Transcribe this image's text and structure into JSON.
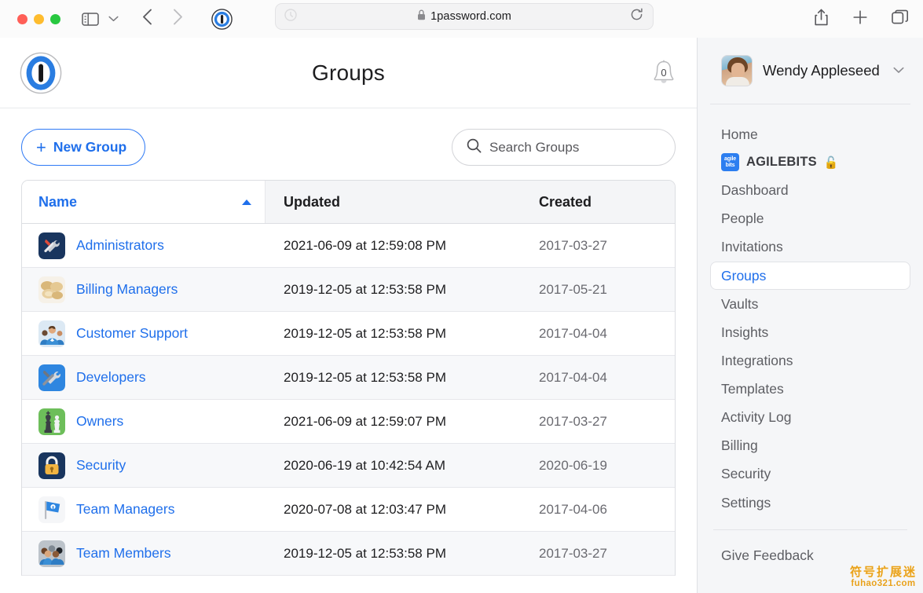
{
  "browser": {
    "url": "1password.com",
    "lock_icon": "lock-icon",
    "traffic_lights": [
      "close",
      "minimize",
      "maximize"
    ],
    "toolbar_icons": [
      "sidebar-toggle-icon",
      "chevron-down-icon",
      "back-arrow-icon",
      "forward-arrow-icon",
      "onepassword-extension-icon",
      "shield-icon",
      "reload-icon",
      "share-icon",
      "new-tab-icon",
      "tab-overview-icon"
    ]
  },
  "header": {
    "title": "Groups",
    "logo_icon": "onepassword-logo-icon",
    "notification_icon": "bell-icon",
    "notification_count": "0"
  },
  "actions": {
    "new_group_label": "New Group",
    "new_group_plus": "+",
    "search_placeholder": "Search Groups",
    "search_value": "",
    "search_icon": "search-icon"
  },
  "table": {
    "columns": [
      "Name",
      "Updated",
      "Created"
    ],
    "sort_column": "Name",
    "sort_direction": "ascending",
    "rows": [
      {
        "name": "Administrators",
        "updated": "2021-06-09 at 12:59:08 PM",
        "created": "2017-03-27",
        "icon": "tools-icon"
      },
      {
        "name": "Billing Managers",
        "updated": "2019-12-05 at 12:53:58 PM",
        "created": "2017-05-21",
        "icon": "coins-icon"
      },
      {
        "name": "Customer Support",
        "updated": "2019-12-05 at 12:53:58 PM",
        "created": "2017-04-04",
        "icon": "support-team-icon"
      },
      {
        "name": "Developers",
        "updated": "2019-12-05 at 12:53:58 PM",
        "created": "2017-04-04",
        "icon": "hammer-wrench-icon"
      },
      {
        "name": "Owners",
        "updated": "2021-06-09 at 12:59:07 PM",
        "created": "2017-03-27",
        "icon": "chess-pieces-icon"
      },
      {
        "name": "Security",
        "updated": "2020-06-19 at 10:42:54 AM",
        "created": "2020-06-19",
        "icon": "padlock-icon"
      },
      {
        "name": "Team Managers",
        "updated": "2020-07-08 at 12:03:47 PM",
        "created": "2017-04-06",
        "icon": "flag-icon"
      },
      {
        "name": "Team Members",
        "updated": "2019-12-05 at 12:53:58 PM",
        "created": "2017-03-27",
        "icon": "people-group-icon"
      }
    ]
  },
  "sidebar": {
    "account_name": "Wendy Appleseed",
    "account_chevron": "chevron-down-icon",
    "avatar": "user-avatar",
    "home_label": "Home",
    "org": {
      "name": "AGILEBITS",
      "logo_top": "agile",
      "logo_bottom": "bits",
      "lock": "🔓"
    },
    "items": [
      {
        "label": "Dashboard",
        "active": false
      },
      {
        "label": "People",
        "active": false
      },
      {
        "label": "Invitations",
        "active": false
      },
      {
        "label": "Groups",
        "active": true
      },
      {
        "label": "Vaults",
        "active": false
      },
      {
        "label": "Insights",
        "active": false
      },
      {
        "label": "Integrations",
        "active": false
      },
      {
        "label": "Templates",
        "active": false
      },
      {
        "label": "Activity Log",
        "active": false
      },
      {
        "label": "Billing",
        "active": false
      },
      {
        "label": "Security",
        "active": false
      },
      {
        "label": "Settings",
        "active": false
      }
    ],
    "feedback_label": "Give Feedback"
  },
  "watermark": {
    "cn": "符号扩展迷",
    "en": "fuhao321.com",
    "color": "#e9a21c"
  },
  "colors": {
    "accent_blue": "#1f6feb",
    "sidebar_bg": "#f5f6f8",
    "row_alt": "#f7f8fa"
  }
}
